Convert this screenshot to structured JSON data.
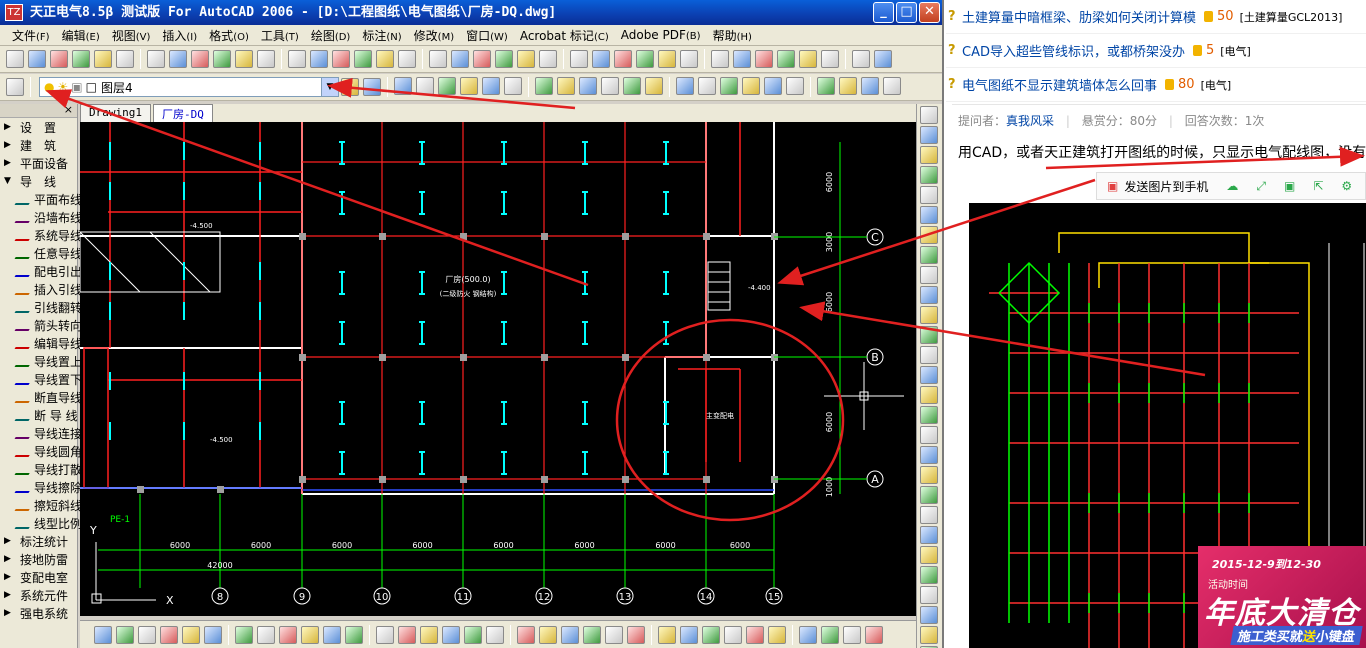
{
  "window": {
    "title": "天正电气8.5β 测试版 For AutoCAD 2006 - [D:\\工程图纸\\电气图纸\\厂房-DQ.dwg]",
    "app_icon": "TZ",
    "minimize": "_",
    "maximize": "□",
    "close": "✕"
  },
  "menu": [
    {
      "label": "文件",
      "key": "(F)"
    },
    {
      "label": "编辑",
      "key": "(E)"
    },
    {
      "label": "视图",
      "key": "(V)"
    },
    {
      "label": "插入",
      "key": "(I)"
    },
    {
      "label": "格式",
      "key": "(O)"
    },
    {
      "label": "工具",
      "key": "(T)"
    },
    {
      "label": "绘图",
      "key": "(D)"
    },
    {
      "label": "标注",
      "key": "(N)"
    },
    {
      "label": "修改",
      "key": "(M)"
    },
    {
      "label": "窗口",
      "key": "(W)"
    },
    {
      "label": "Acrobat 标记",
      "key": "(C)"
    },
    {
      "label": "Adobe PDF",
      "key": "(B)"
    },
    {
      "label": "帮助",
      "key": "(H)"
    }
  ],
  "layer": {
    "current": "图层4"
  },
  "drawing_tabs": [
    {
      "label": "Drawing1",
      "active": false
    },
    {
      "label": "厂房-DQ",
      "active": true
    }
  ],
  "left_panel": [
    {
      "label": "设　置",
      "marker": "▶"
    },
    {
      "label": "建　筑",
      "marker": "▶"
    },
    {
      "label": "平面设备",
      "marker": "▶"
    },
    {
      "label": "导　线",
      "marker": "▼"
    },
    {
      "label": "平面布线",
      "marker": ""
    },
    {
      "label": "沿墙布线",
      "marker": ""
    },
    {
      "label": "系统导线",
      "marker": ""
    },
    {
      "label": "任意导线",
      "marker": ""
    },
    {
      "label": "配电引出",
      "marker": ""
    },
    {
      "label": "插入引线",
      "marker": ""
    },
    {
      "label": "引线翻转",
      "marker": ""
    },
    {
      "label": "箭头转向",
      "marker": ""
    },
    {
      "label": "编辑导线",
      "marker": ""
    },
    {
      "label": "导线置上",
      "marker": ""
    },
    {
      "label": "导线置下",
      "marker": ""
    },
    {
      "label": "断直导线",
      "marker": ""
    },
    {
      "label": "断 导 线",
      "marker": ""
    },
    {
      "label": "导线连接",
      "marker": ""
    },
    {
      "label": "导线圆角",
      "marker": ""
    },
    {
      "label": "导线打散",
      "marker": ""
    },
    {
      "label": "导线擦除",
      "marker": ""
    },
    {
      "label": "擦短斜线",
      "marker": ""
    },
    {
      "label": "线型比例",
      "marker": ""
    },
    {
      "label": "标注统计",
      "marker": "▶"
    },
    {
      "label": "接地防雷",
      "marker": "▶"
    },
    {
      "label": "变配电室",
      "marker": "▶"
    },
    {
      "label": "系统元件",
      "marker": "▶"
    },
    {
      "label": "强电系统",
      "marker": "▶"
    }
  ],
  "drawing": {
    "room_label": "厂房(500.0)",
    "room_sub": "(二级防火 钢结构)",
    "room_label2": "主变配电",
    "elev_1": "-4.500",
    "elev_2": "-4.400",
    "elev_3": "-4.500",
    "dims": [
      "6000",
      "6000",
      "6000",
      "6000",
      "6000",
      "6000",
      "6000",
      "6000"
    ],
    "total_dim": "42000",
    "axis_numbers": [
      "8",
      "9",
      "10",
      "11",
      "12",
      "13",
      "14",
      "15"
    ],
    "axis_letters": [
      "C",
      "B",
      "A"
    ],
    "side_dims": [
      "6000",
      "3000",
      "6000",
      "6000",
      "1000"
    ],
    "tag_pe": "PE-1",
    "ucs_x": "X",
    "ucs_y": "Y"
  },
  "web": {
    "related": [
      {
        "title": "土建算量中暗框梁、肋梁如何关闭计算模",
        "points": "50",
        "category": "[土建算量GCL2013]"
      },
      {
        "title": "CAD导入超些管线标识，或都桥架没办",
        "points": "5",
        "category": "[电气]"
      },
      {
        "title": "电气图纸不显示建筑墙体怎么回事",
        "points": "80",
        "category": "[电气]"
      }
    ],
    "asker_label": "提问者：",
    "asker": "真我风采",
    "reward": "悬赏分：80分",
    "answers": "回答次数：1次",
    "question": "用CAD，或者天正建筑打开图纸的时候，只显示电气配线图，没有",
    "send_phone": "发送图片到手机",
    "ad": {
      "date": "2015-12-9到12-30",
      "tag": "活动时间",
      "headline": "年底大清仓",
      "slogan_pre": "施工类买就",
      "slogan_hl": "送",
      "slogan_post": "小键盘"
    }
  },
  "colors": {
    "cad_bg": "#000000",
    "wall": "#ffffff",
    "wire_red": "#ff2020",
    "fixture": "#00ffff",
    "axis_green": "#00ff00",
    "annotation_red": "#e02020"
  }
}
